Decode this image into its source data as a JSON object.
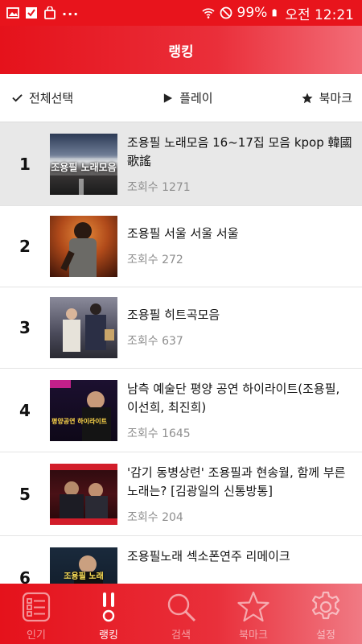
{
  "status_bar": {
    "battery": "99%",
    "time": "오전 12:21",
    "overflow": "..."
  },
  "header": {
    "title": "랭킹"
  },
  "toolbar": {
    "select_all": "전체선택",
    "play": "플레이",
    "bookmark": "북마크"
  },
  "items": [
    {
      "rank": "1",
      "title": "조용필 노래모음 16~17집 모음 kpop 韓國歌謠",
      "views": "조회수 1271",
      "thumb_caption": "조용필 노래모음"
    },
    {
      "rank": "2",
      "title": "조용필   서울 서울 서울",
      "views": "조회수 272"
    },
    {
      "rank": "3",
      "title": "조용필 히트곡모음",
      "views": "조회수 637"
    },
    {
      "rank": "4",
      "title": "남측 예술단 평양 공연 하이라이트(조용필, 이선희, 최진희)",
      "views": "조회수 1645",
      "thumb_caption": "평양공연 하이라이트"
    },
    {
      "rank": "5",
      "title": "'감기 동병상련' 조용필과 현송월, 함께 부른 노래는? [김광일의 신통방통]",
      "views": "조회수 204"
    },
    {
      "rank": "6",
      "title": "조용필노래 섹소폰연주 리메이크",
      "views": "",
      "thumb_caption": "조용필 노래"
    }
  ],
  "nav": [
    {
      "label": "인기",
      "icon": "list-icon",
      "active": false
    },
    {
      "label": "랭킹",
      "icon": "ranking-icon",
      "active": true
    },
    {
      "label": "검색",
      "icon": "search-icon",
      "active": false
    },
    {
      "label": "북마크",
      "icon": "star-icon",
      "active": false
    },
    {
      "label": "설정",
      "icon": "gear-icon",
      "active": false
    }
  ],
  "colors": {
    "brand": "#e5121b",
    "selected_row": "#e8e8e8",
    "muted_text": "#8e8e8e"
  }
}
